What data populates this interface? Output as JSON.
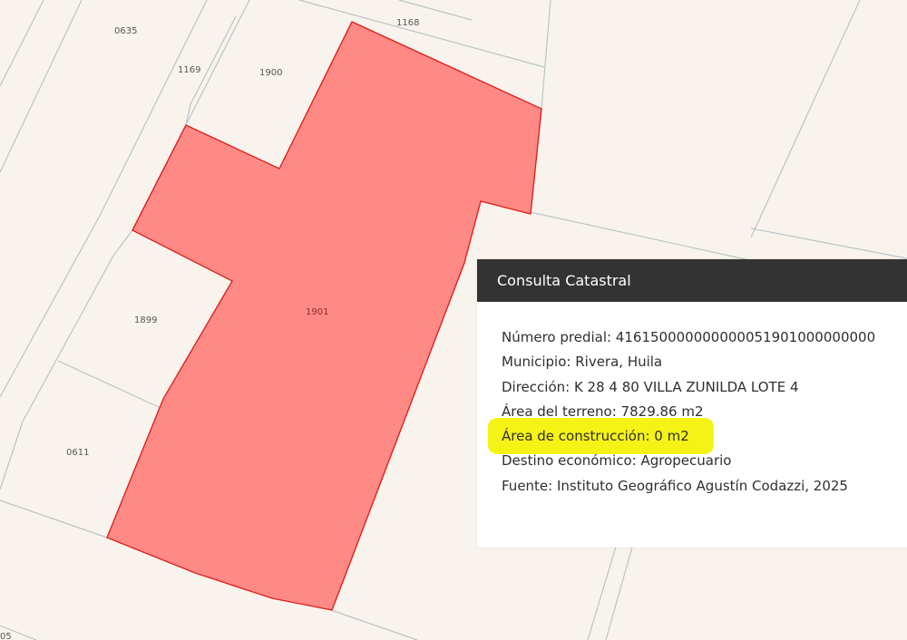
{
  "map": {
    "parcel_labels": {
      "p0635": "0635",
      "p1168": "1168",
      "p1169": "1169",
      "p1900": "1900",
      "p1901": "1901",
      "p1899": "1899",
      "p0611": "0611",
      "p05": "05"
    },
    "selected_parcel_color": "#ff8a85",
    "selected_parcel_border": "#e02020",
    "parcel_line_color": "#b9c4c8",
    "background_color": "#f8f4ed"
  },
  "panel": {
    "title": "Consulta Catastral",
    "header_color": "#333333",
    "lines": {
      "numero": "Número predial: 416150000000000051901000000000",
      "municipio": "Municipio: Rivera, Huila",
      "direccion": "Dirección: K 28 4 80 VILLA ZUNILDA LOTE 4",
      "area_terreno": "Área del terreno: 7829.86 m2",
      "area_construccion": "Área de construcción: 0 m2",
      "destino": "Destino económico: Agropecuario",
      "fuente": "Fuente: Instituto Geográfico Agustín Codazzi, 2025"
    },
    "highlight_color": "#f4f20a"
  }
}
